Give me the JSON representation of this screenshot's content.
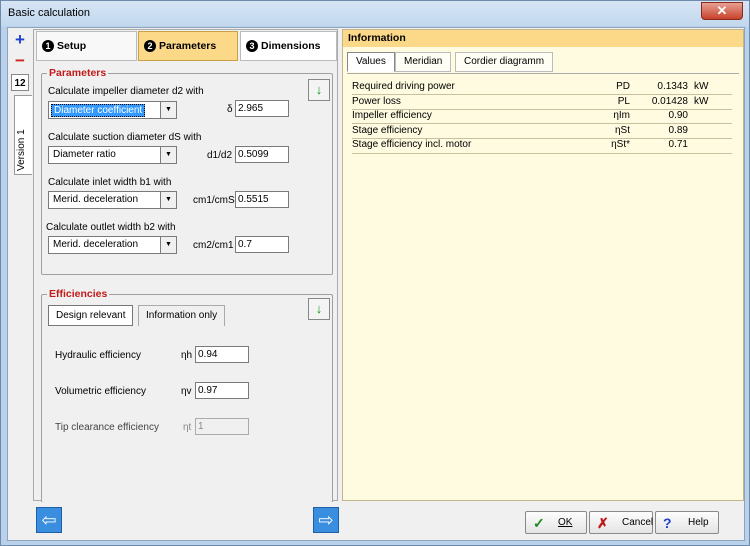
{
  "window": {
    "title": "Basic calculation",
    "close_symbol": "✕"
  },
  "left_toolbar": {
    "add_symbol": "+",
    "remove_symbol": "−",
    "counter_label": "12",
    "version_tab": "Version 1"
  },
  "tabs": [
    {
      "num": "1",
      "label": "Setup"
    },
    {
      "num": "2",
      "label": "Parameters"
    },
    {
      "num": "3",
      "label": "Dimensions"
    }
  ],
  "parameters": {
    "title": "Parameters",
    "rows": [
      {
        "label": "Calculate impeller diameter d2 with",
        "option": "Diameter coefficient",
        "symbol": "δ",
        "value": "2.965"
      },
      {
        "label": "Calculate suction diameter dS with",
        "option": "Diameter ratio",
        "symbol": "d1/d2",
        "value": "0.5099"
      },
      {
        "label": "Calculate inlet width b1 with",
        "option": "Merid. deceleration",
        "symbol": "cm1/cmS",
        "value": "0.5515"
      },
      {
        "label": "Calculate outlet width b2 with",
        "option": "Merid. deceleration",
        "symbol": "cm2/cm1",
        "value": "0.7"
      }
    ]
  },
  "efficiencies": {
    "title": "Efficiencies",
    "tabs": [
      "Design relevant",
      "Information only"
    ],
    "rows": [
      {
        "label": "Hydraulic efficiency",
        "symbol": "ηh",
        "value": "0.94"
      },
      {
        "label": "Volumetric efficiency",
        "symbol": "ηv",
        "value": "0.97"
      },
      {
        "label": "Tip clearance efficiency",
        "symbol": "ηt",
        "value": "1"
      }
    ]
  },
  "arrow_down_symbol": "↓",
  "nav": {
    "back_symbol": "⇦",
    "forward_symbol": "⇨"
  },
  "information": {
    "title": "Information",
    "tabs": [
      "Values",
      "Meridian",
      "Cordier diagramm"
    ],
    "rows": [
      {
        "name": "Required driving power",
        "symbol": "PD",
        "value": "0.1343",
        "unit": "kW"
      },
      {
        "name": "Power loss",
        "symbol": "PL",
        "value": "0.01428",
        "unit": "kW"
      },
      {
        "name": "Impeller efficiency",
        "symbol": "ηIm",
        "value": "0.90",
        "unit": ""
      },
      {
        "name": "Stage efficiency",
        "symbol": "ηSt",
        "value": "0.89",
        "unit": ""
      },
      {
        "name": "Stage efficiency incl. motor",
        "symbol": "ηSt*",
        "value": "0.71",
        "unit": ""
      }
    ]
  },
  "buttons": {
    "ok": "OK",
    "cancel": "Cancel",
    "help": "Help",
    "ok_icon": "✓",
    "cancel_icon": "✗",
    "help_icon": "?"
  },
  "colors": {
    "accent_tab": "#fcd889",
    "group_title": "#c21a1a",
    "info_bg": "#fffbe0"
  }
}
